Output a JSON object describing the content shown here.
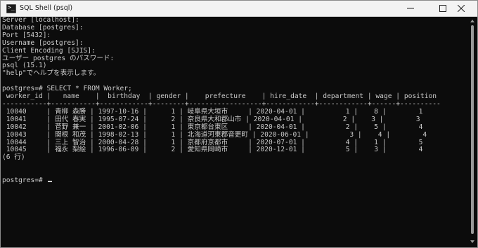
{
  "window": {
    "title": "SQL Shell (psql)",
    "app_icon_glyph": ">_"
  },
  "colors": {
    "console_background": "#0c0c0c",
    "console_text": "#cccccc",
    "titlebar_background": "#f3f3f3"
  },
  "console": {
    "lines": [
      "Server [localhost]:",
      "Database [postgres]:",
      "Port [5432]:",
      "Username [postgres]:",
      "Client Encoding [SJIS]:",
      "ユーザー postgres のパスワード:",
      "psql (15.1)",
      "\"help\"でヘルプを表示します。",
      "",
      "postgres=# SELECT * FROM Worker;",
      " worker_id |   name    |  birthday  | gender |    prefecture    | hire_date  | department | wage | position",
      "-----------+-----------+------------+--------+------------------+------------+------------+------+----------",
      " 10040     | 青柳 森勝 | 1997-10-16 |      1 | 岐阜県大垣市     | 2020-04-01 |          1 |    8 |        1",
      " 10041     | 田代 春実 | 1995-07-24 |      2 | 奈良県大和郡山市 | 2020-04-01 |          2 |    3 |        3",
      " 10042     | 菅野 兼一 | 2001-02-06 |      1 | 東京都台東区     | 2020-04-01 |          2 |    5 |        4",
      " 10043     | 関根 和茂 | 1998-02-13 |      1 | 北海道河東郡音更町 | 2020-06-01 |          3 |    4 |        4",
      " 10044     | 三上 智治 | 2000-04-28 |      1 | 京都府京都市     | 2020-07-01 |          4 |    1 |        5",
      " 10045     | 福永 梨絵 | 1996-06-09 |      2 | 愛知県岡崎市     | 2020-12-01 |          5 |    3 |        4",
      "(6 行)",
      "",
      ""
    ],
    "prompt": "postgres=# "
  }
}
